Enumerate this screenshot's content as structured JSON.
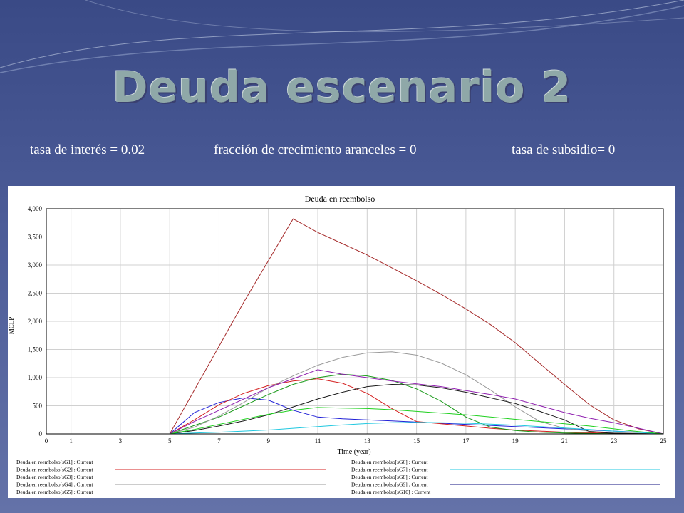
{
  "slide": {
    "title": "Deuda escenario 2",
    "params": [
      "tasa de  interés = 0.02",
      "fracción de crecimiento aranceles = 0",
      "tasa de subsidio= 0"
    ]
  },
  "chart_data": {
    "type": "line",
    "title": "Deuda en reembolso",
    "xlabel": "Time (year)",
    "ylabel": "MCLP",
    "xlim": [
      0,
      25
    ],
    "ylim": [
      0,
      4000
    ],
    "xticks": [
      "0",
      "1",
      "3",
      "5",
      "7",
      "9",
      "11",
      "13",
      "15",
      "17",
      "19",
      "21",
      "23",
      "25"
    ],
    "yticks": [
      "0",
      "500",
      "1,000",
      "1,500",
      "2,000",
      "2,500",
      "3,000",
      "3,500",
      "4,000"
    ],
    "grid": true,
    "legend_position": "bottom",
    "x": [
      0,
      1,
      2,
      3,
      4,
      5,
      6,
      7,
      8,
      9,
      10,
      11,
      12,
      13,
      14,
      15,
      16,
      17,
      18,
      19,
      20,
      21,
      22,
      23,
      24,
      25
    ],
    "series": [
      {
        "name": "Deuda en reembolso[sG1] : Current",
        "color": "#1f1fd6",
        "values": [
          0,
          0,
          0,
          0,
          0,
          0,
          380,
          560,
          640,
          600,
          420,
          300,
          270,
          250,
          230,
          210,
          190,
          170,
          150,
          130,
          110,
          90,
          70,
          50,
          30,
          0
        ]
      },
      {
        "name": "Deuda en reembolso[sG2] : Current",
        "color": "#d42020",
        "values": [
          0,
          0,
          0,
          0,
          0,
          0,
          250,
          520,
          720,
          860,
          940,
          980,
          900,
          720,
          450,
          220,
          180,
          140,
          100,
          70,
          50,
          30,
          20,
          10,
          5,
          0
        ]
      },
      {
        "name": "Deuda en reembolso[sG3] : Current",
        "color": "#1a9a1a",
        "values": [
          0,
          0,
          0,
          0,
          0,
          0,
          150,
          300,
          500,
          700,
          880,
          1000,
          1060,
          1030,
          950,
          800,
          580,
          300,
          120,
          60,
          30,
          15,
          8,
          4,
          2,
          0
        ]
      },
      {
        "name": "Deuda en reembolso[sG4] : Current",
        "color": "#9a9a9a",
        "values": [
          0,
          0,
          0,
          0,
          0,
          0,
          120,
          320,
          560,
          820,
          1030,
          1220,
          1360,
          1440,
          1460,
          1400,
          1260,
          1050,
          780,
          480,
          220,
          100,
          50,
          20,
          10,
          0
        ]
      },
      {
        "name": "Deuda en reembolso[sG5] : Current",
        "color": "#1a1a1a",
        "values": [
          0,
          0,
          0,
          0,
          0,
          0,
          60,
          140,
          230,
          340,
          480,
          620,
          740,
          840,
          880,
          870,
          820,
          740,
          640,
          540,
          400,
          250,
          40,
          10,
          5,
          0
        ]
      },
      {
        "name": "Deuda en reembolso[sG6] : Current",
        "color": "#a52a2a",
        "values": [
          0,
          0,
          0,
          0,
          0,
          0,
          780,
          1560,
          2340,
          3080,
          3820,
          3580,
          3380,
          3180,
          2950,
          2720,
          2480,
          2220,
          1940,
          1620,
          1250,
          880,
          520,
          250,
          90,
          0
        ]
      },
      {
        "name": "Deuda en reembolso[sG7] : Current",
        "color": "#20c8e0",
        "values": [
          0,
          0,
          0,
          0,
          0,
          0,
          15,
          30,
          50,
          70,
          100,
          130,
          160,
          185,
          200,
          205,
          200,
          190,
          175,
          155,
          130,
          105,
          80,
          50,
          25,
          0
        ]
      },
      {
        "name": "Deuda en reembolso[sG8] : Current",
        "color": "#9020b0",
        "values": [
          0,
          0,
          0,
          0,
          0,
          0,
          220,
          420,
          620,
          820,
          980,
          1140,
          1060,
          1000,
          940,
          890,
          840,
          770,
          700,
          620,
          500,
          380,
          280,
          200,
          100,
          0
        ]
      },
      {
        "name": "Deuda en reembolso[sG9] : Current",
        "color": "#101080",
        "values": [
          0,
          0,
          0,
          0,
          0,
          0,
          0,
          0,
          0,
          0,
          0,
          0,
          0,
          0,
          0,
          0,
          0,
          0,
          0,
          0,
          0,
          0,
          0,
          0,
          0,
          0
        ]
      },
      {
        "name": "Deuda en reembolso[sG10] : Current",
        "color": "#20d020",
        "values": [
          0,
          0,
          0,
          0,
          0,
          0,
          80,
          170,
          260,
          350,
          420,
          470,
          460,
          450,
          430,
          400,
          370,
          340,
          300,
          260,
          220,
          180,
          140,
          90,
          40,
          0
        ]
      }
    ]
  }
}
